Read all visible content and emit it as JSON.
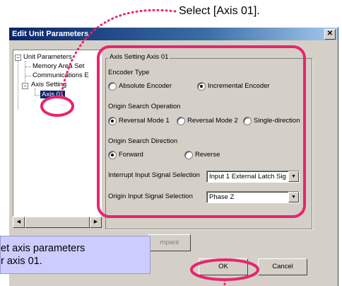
{
  "annotation_top": "Select [Axis 01].",
  "callout": {
    "line1": "et axis parameters",
    "line2": "r axis 01."
  },
  "dialog": {
    "title": "Edit Unit Parameters",
    "close_glyph": "✕"
  },
  "tree": {
    "items": [
      {
        "label": "Unit Parameters",
        "expander": "−"
      },
      {
        "label": "Memory Area Set"
      },
      {
        "label": "Communications E"
      },
      {
        "label": "Axis Setting",
        "expander": "−"
      },
      {
        "label": "Axis 01",
        "selected": true
      }
    ]
  },
  "settings": {
    "group_title": "Axis Setting Axis 01",
    "encoder_type": {
      "label": "Encoder Type",
      "options": [
        "Absolute Encoder",
        "Incremental Encoder"
      ],
      "selected": "Incremental Encoder"
    },
    "origin_search_operation": {
      "label": "Origin Search Operation",
      "options": [
        "Reversal Mode 1",
        "Reversal Mode 2",
        "Single-direction"
      ],
      "selected": "Reversal Mode 1"
    },
    "origin_search_direction": {
      "label": "Origin Search Direction",
      "options": [
        "Forward",
        "Reverse"
      ],
      "selected": "Forward"
    },
    "interrupt_input": {
      "label": "Interrupt Input Signal Selection",
      "value": "Input 1 External  Latch Sig"
    },
    "origin_input": {
      "label": "Origin Input Signal Selection",
      "value": "Phase Z"
    }
  },
  "buttons": {
    "compare": "mpare",
    "ok": "OK",
    "cancel": "Cancel"
  },
  "colors": {
    "highlight": "#e8256e",
    "callout_bg": "#ccccff",
    "title_bar": "#0a246a"
  }
}
